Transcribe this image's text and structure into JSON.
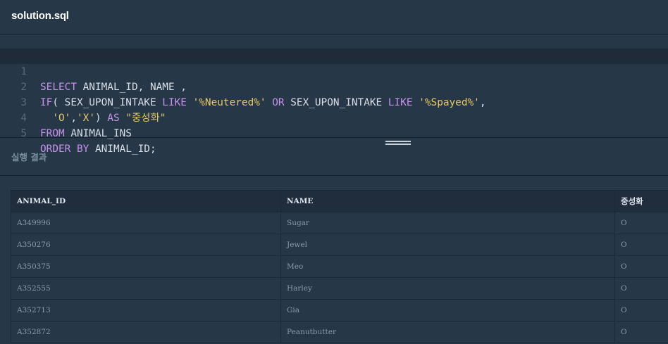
{
  "tab": {
    "title": "solution.sql"
  },
  "editor": {
    "lines": [
      {
        "number": "1",
        "tokens": [
          {
            "t": "kw",
            "v": "SELECT"
          },
          {
            "t": "plain",
            "v": " ANIMAL_ID, NAME ,"
          }
        ]
      },
      {
        "number": "2",
        "tokens": [
          {
            "t": "kw",
            "v": "IF"
          },
          {
            "t": "plain",
            "v": "( SEX_UPON_INTAKE "
          },
          {
            "t": "kw",
            "v": "LIKE"
          },
          {
            "t": "plain",
            "v": " "
          },
          {
            "t": "str",
            "v": "'%Neutered%'"
          },
          {
            "t": "plain",
            "v": " "
          },
          {
            "t": "kw",
            "v": "OR"
          },
          {
            "t": "plain",
            "v": " SEX_UPON_INTAKE "
          },
          {
            "t": "kw",
            "v": "LIKE"
          },
          {
            "t": "plain",
            "v": " "
          },
          {
            "t": "str",
            "v": "'%Spayed%'"
          },
          {
            "t": "plain",
            "v": ","
          }
        ]
      },
      {
        "number": "3",
        "tokens": [
          {
            "t": "plain",
            "v": "  "
          },
          {
            "t": "str",
            "v": "'O'"
          },
          {
            "t": "plain",
            "v": ","
          },
          {
            "t": "str",
            "v": "'X'"
          },
          {
            "t": "plain",
            "v": ") "
          },
          {
            "t": "kw",
            "v": "AS"
          },
          {
            "t": "plain",
            "v": " "
          },
          {
            "t": "str",
            "v": "\"중성화\""
          }
        ]
      },
      {
        "number": "4",
        "tokens": [
          {
            "t": "kw",
            "v": "FROM"
          },
          {
            "t": "plain",
            "v": " ANIMAL_INS"
          }
        ]
      },
      {
        "number": "5",
        "tokens": [
          {
            "t": "kw",
            "v": "ORDER BY"
          },
          {
            "t": "plain",
            "v": " ANIMAL_ID;"
          }
        ]
      }
    ]
  },
  "results": {
    "title": "실행 결과",
    "columns": [
      "ANIMAL_ID",
      "NAME",
      "중성화"
    ],
    "rows": [
      [
        "A349996",
        "Sugar",
        "O"
      ],
      [
        "A350276",
        "Jewel",
        "O"
      ],
      [
        "A350375",
        "Meo",
        "O"
      ],
      [
        "A352555",
        "Harley",
        "O"
      ],
      [
        "A352713",
        "Gia",
        "O"
      ],
      [
        "A352872",
        "Peanutbutter",
        "O"
      ]
    ]
  },
  "colors": {
    "background": "#263747",
    "keyword": "#c792ea",
    "string": "#e6c86b",
    "identifier": "#d8dee6",
    "line_number": "#566b80"
  }
}
